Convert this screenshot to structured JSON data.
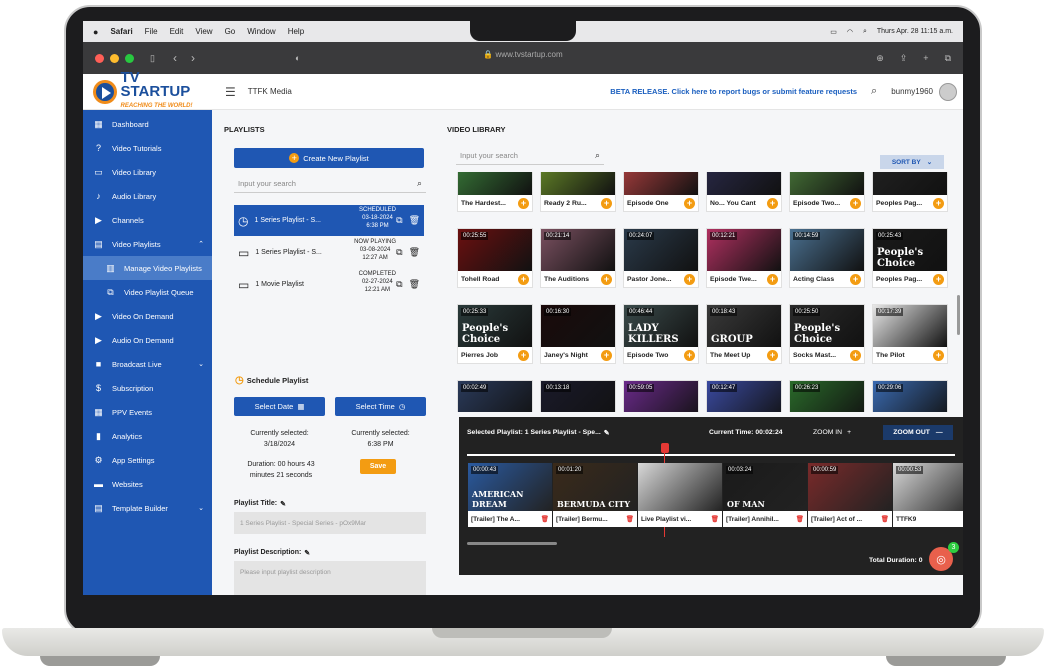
{
  "os": {
    "menu": [
      "Safari",
      "File",
      "Edit",
      "View",
      "Go",
      "Window",
      "Help"
    ],
    "datetime": "Thurs Apr. 28 11:15 a.m."
  },
  "browser": {
    "url": "www.tvstartup.com"
  },
  "header": {
    "logo_text": "TV STARTUP",
    "logo_tagline": "REACHING THE WORLD!",
    "org": "TTFK Media",
    "beta": "BETA RELEASE. Click here to report bugs or submit feature requests",
    "username": "bunmy1960"
  },
  "sidebar": {
    "items": [
      {
        "label": "Dashboard",
        "icon": "▦",
        "name": "dashboard-icon"
      },
      {
        "label": "Video Tutorials",
        "icon": "?",
        "name": "help-icon"
      },
      {
        "label": "Video Library",
        "icon": "▭",
        "name": "video-icon"
      },
      {
        "label": "Audio Library",
        "icon": "♪",
        "name": "music-icon"
      },
      {
        "label": "Channels",
        "icon": "▶",
        "name": "channel-icon"
      },
      {
        "label": "Video Playlists",
        "icon": "▤",
        "name": "playlist-icon",
        "chev": "⌃"
      },
      {
        "label": "Manage Video Playlists",
        "icon": "▥",
        "name": "manage-playlist-icon",
        "sub": true,
        "active": true
      },
      {
        "label": "Video Playlist Queue",
        "icon": "⧉",
        "name": "queue-icon",
        "sub": true
      },
      {
        "label": "Video On Demand",
        "icon": "▶",
        "name": "vod-icon"
      },
      {
        "label": "Audio On Demand",
        "icon": "▶",
        "name": "aod-icon"
      },
      {
        "label": "Broadcast Live",
        "icon": "■",
        "name": "broadcast-icon",
        "chev": "⌄"
      },
      {
        "label": "Subscription",
        "icon": "$",
        "name": "dollar-icon"
      },
      {
        "label": "PPV Events",
        "icon": "▦",
        "name": "calendar-icon"
      },
      {
        "label": "Analytics",
        "icon": "▮",
        "name": "analytics-icon"
      },
      {
        "label": "App Settings",
        "icon": "⚙",
        "name": "gear-icon"
      },
      {
        "label": "Websites",
        "icon": "▬",
        "name": "website-icon"
      },
      {
        "label": "Template Builder",
        "icon": "▤",
        "name": "template-icon",
        "chev": "⌄"
      }
    ]
  },
  "playlists": {
    "title": "PLAYLISTS",
    "create_label": "Create New Playlist",
    "search_placeholder": "Input your search",
    "items": [
      {
        "title": "1 Series Playlist - S...",
        "status": "SCHEDULED",
        "date": "03-18-2024",
        "time": "6:38 PM",
        "selected": true,
        "icon": "clock-icon"
      },
      {
        "title": "1 Series Playlist - S...",
        "status": "NOW PLAYING",
        "date": "03-08-2024",
        "time": "12:27 AM",
        "selected": false,
        "icon": "tv-icon"
      },
      {
        "title": "1 Movie Playlist",
        "status": "COMPLETED",
        "date": "02-27-2024",
        "time": "12:21 AM",
        "selected": false,
        "icon": "tv-icon"
      }
    ]
  },
  "schedule": {
    "title": "Schedule Playlist",
    "select_date": "Select Date",
    "select_time": "Select Time",
    "date_caption": "Currently selected:",
    "date_value": "3/18/2024",
    "time_caption": "Currently selected:",
    "time_value": "6:38 PM",
    "duration": "Duration: 00 hours 43 minutes 21 seconds",
    "save": "Save",
    "playlist_title_label": "Playlist Title:",
    "playlist_title_value": "1 Series Playlist - Special Series - pOx9Mar",
    "description_label": "Playlist Description:",
    "description_placeholder": "Please input playlist description"
  },
  "library": {
    "title": "VIDEO LIBRARY",
    "search_placeholder": "Input your search",
    "sort_label": "SORT BY",
    "rows": [
      [
        {
          "title": "The Hardest...",
          "dur": "",
          "color": "#3a7d3a"
        },
        {
          "title": "Ready 2 Ru...",
          "dur": "",
          "color": "#6a8d2a"
        },
        {
          "title": "Episode One",
          "dur": "",
          "color": "#b04040"
        },
        {
          "title": "No... You Cant",
          "dur": "",
          "color": "#2a2a4a"
        },
        {
          "title": "Episode Two...",
          "dur": "",
          "color": "#4a7a3a"
        },
        {
          "title": "Peoples Pag...",
          "dur": "",
          "color": "#222222"
        }
      ],
      [
        {
          "title": "Tohell Road",
          "dur": "00:25:55",
          "color": "#6b1010"
        },
        {
          "title": "The Auditions",
          "dur": "00:21:14",
          "color": "#7a5060"
        },
        {
          "title": "Pastor Jone...",
          "dur": "00:24:07",
          "color": "#2a3a4a"
        },
        {
          "title": "Episode Twe...",
          "dur": "00:12:21",
          "color": "#b03060"
        },
        {
          "title": "Acting Class",
          "dur": "00:14:59",
          "color": "#4a7090"
        },
        {
          "title": "Peoples Pag...",
          "dur": "00:25:43",
          "color": "#1a1a1a",
          "overlay": "People's Choice"
        }
      ],
      [
        {
          "title": "Pierres Job",
          "dur": "00:25:33",
          "color": "#2a3a3a",
          "overlay": "People's Choice"
        },
        {
          "title": "Janey's Night",
          "dur": "00:16:30",
          "color": "#1a0a0a"
        },
        {
          "title": "Episode Two",
          "dur": "00:46:44",
          "color": "#3a4a4a",
          "overlay": "LADY KILLERS"
        },
        {
          "title": "The Meet Up",
          "dur": "00:18:43",
          "color": "#3a3a3a",
          "overlay": "GROUP"
        },
        {
          "title": "Socks Mast...",
          "dur": "00:25:50",
          "color": "#2a2a2a",
          "overlay": "People's Choice"
        },
        {
          "title": "The Pilot",
          "dur": "00:17:39",
          "color": "#e8e8e8"
        }
      ],
      [
        {
          "title": "",
          "dur": "00:02:49",
          "color": "#2a3a5a"
        },
        {
          "title": "",
          "dur": "00:13:18",
          "color": "#1a1a2a"
        },
        {
          "title": "",
          "dur": "00:59:05",
          "color": "#6a2a8a"
        },
        {
          "title": "",
          "dur": "00:12:47",
          "color": "#3a4aa0"
        },
        {
          "title": "",
          "dur": "00:26:23",
          "color": "#2a6a2a"
        },
        {
          "title": "",
          "dur": "00:29:06",
          "color": "#3a6ab0"
        }
      ]
    ]
  },
  "timeline": {
    "selected": "Selected Playlist: 1 Series Playlist - Spe...",
    "current_time": "Current Time: 00:02:24",
    "zoom_in": "ZOOM IN",
    "zoom_out": "ZOOM OUT",
    "total_duration": "Total Duration: 0",
    "badge": "3",
    "clips": [
      {
        "title": "[Trailer] The A...",
        "dur": "00:00:43",
        "color": "#2a5aa0",
        "overlay": "AMERICAN DREAM"
      },
      {
        "title": "[Trailer] Bermu...",
        "dur": "00:01:20",
        "color": "#3a2a1a",
        "overlay": "BERMUDA CITY"
      },
      {
        "title": "Live Playlist vi...",
        "dur": "",
        "color": "#d8d8d8"
      },
      {
        "title": "[Trailer] Annihil...",
        "dur": "00:03:24",
        "color": "#1a1a1a",
        "overlay": "OF MAN"
      },
      {
        "title": "[Trailer] Act of ...",
        "dur": "00:00:59",
        "color": "#7a2a2a"
      },
      {
        "title": "TTFK9",
        "dur": "00:00:53",
        "color": "#d8d8d8"
      }
    ]
  }
}
